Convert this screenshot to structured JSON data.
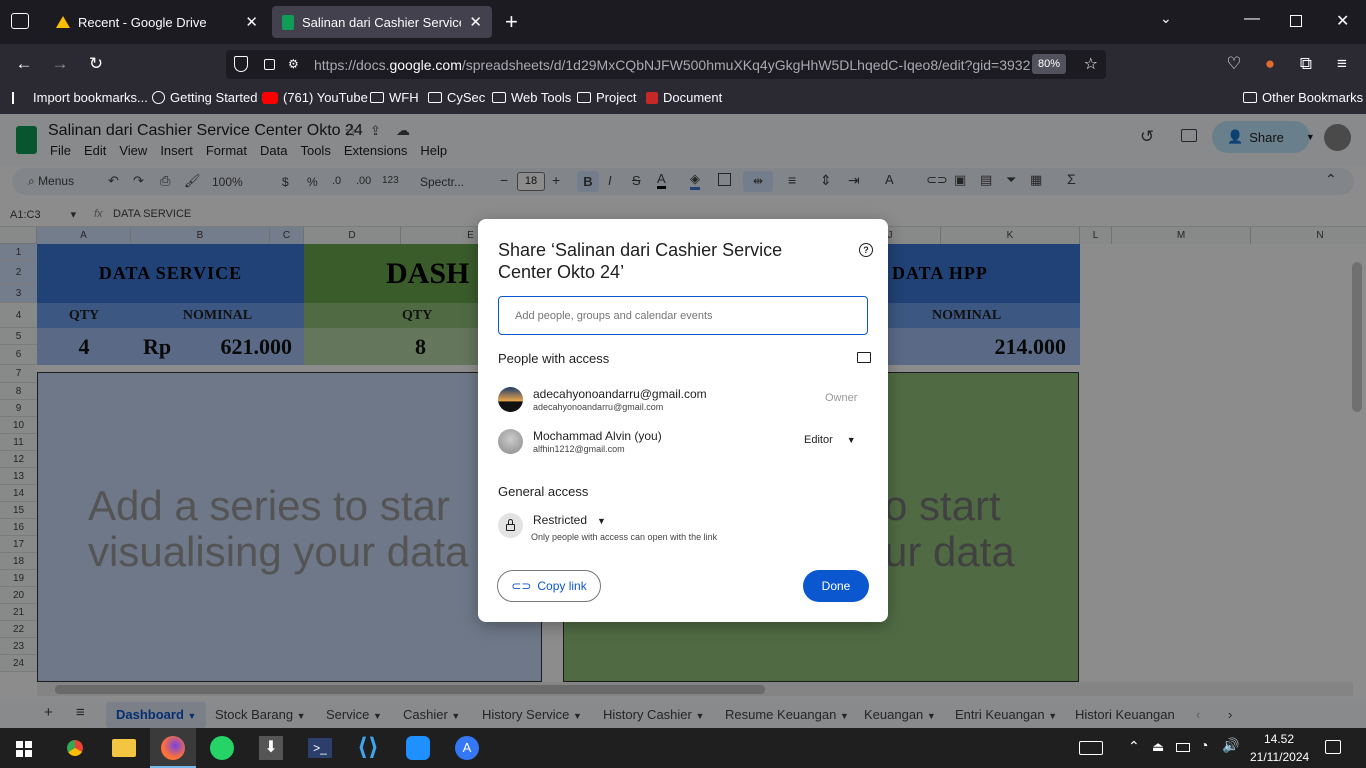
{
  "browser": {
    "tabs": [
      {
        "title": "Recent - Google Drive",
        "active": false
      },
      {
        "title": "Salinan dari Cashier Service Center",
        "active": true
      }
    ],
    "url_prefix": "https://docs.",
    "url_domain": "google.com",
    "url_rest": "/spreadsheets/d/1d29MxCQbNJFW500hmuXKq4yGkgHhW5DLhqedC-Iqeo8/edit?gid=3932",
    "zoom": "80%",
    "bookmarks": [
      "Import bookmarks...",
      "Getting Started",
      "(761) YouTube",
      "WFH",
      "CySec",
      "Web Tools",
      "Project",
      "Document"
    ],
    "other_bookmarks": "Other Bookmarks"
  },
  "sheets": {
    "doc_title": "Salinan dari Cashier Service Center Okto 24",
    "menu": [
      "File",
      "Edit",
      "View",
      "Insert",
      "Format",
      "Data",
      "Tools",
      "Extensions",
      "Help"
    ],
    "share_label": "Share",
    "toolbar": {
      "menus": "Menus",
      "zoom": "100%",
      "currency": "$",
      "percent": "%",
      "dec_less": ".0",
      "dec_more": ".00",
      "number_format": "123",
      "font": "Spectr...",
      "font_size": "18"
    },
    "cell_ref": "A1:C3",
    "fx": "fx",
    "formula": "DATA SERVICE",
    "columns": [
      "A",
      "B",
      "C",
      "D",
      "E",
      "J",
      "K",
      "L",
      "M",
      "N"
    ],
    "rows": [
      "1",
      "2",
      "3",
      "4",
      "5",
      "6",
      "7",
      "8",
      "9",
      "10",
      "11",
      "12",
      "13",
      "14",
      "15",
      "16",
      "17",
      "18",
      "19",
      "20",
      "21",
      "22",
      "23",
      "24"
    ],
    "cells": {
      "data_service": "DATA SERVICE",
      "dash": "DASH",
      "data_hpp": "DATA HPP",
      "qty": "QTY",
      "nominal": "NOMINAL",
      "qty2": "QTY",
      "nominal2": "NOMINAL",
      "val_qty": "4",
      "val_rp": "Rp",
      "val_nominal": "621.000",
      "val_qty2": "8",
      "val_hpp": "214.000"
    },
    "chart_placeholder_left_1": "Add a series to star",
    "chart_placeholder_left_2": "visualising your data",
    "chart_placeholder_right_1": "o start",
    "chart_placeholder_right_2": "ur data",
    "sheet_tabs": [
      "Dashboard",
      "Stock Barang",
      "Service",
      "Cashier",
      "History Service",
      "History Cashier",
      "Resume Keuangan",
      "Keuangan",
      "Entri Keuangan",
      "Histori Keuangan"
    ]
  },
  "dialog": {
    "title": "Share ‘Salinan dari Cashier Service Center Okto 24’",
    "input_placeholder": "Add people, groups and calendar events",
    "people_heading": "People with access",
    "people": [
      {
        "name": "adecahyonoandarru@gmail.com",
        "email": "adecahyonoandarru@gmail.com",
        "role": "Owner"
      },
      {
        "name": "Mochammad Alvin (you)",
        "email": "alfhin1212@gmail.com",
        "role": "Editor"
      }
    ],
    "general_heading": "General access",
    "access_level": "Restricted",
    "access_desc": "Only people with access can open with the link",
    "copy_link": "Copy link",
    "done": "Done"
  },
  "taskbar": {
    "time": "14.52",
    "date": "21/11/2024"
  },
  "colors": {
    "accent": "#0b57d0",
    "header_blue": "#3c78d8",
    "header_green": "#6aa84f",
    "light_blue": "#c9daf8"
  }
}
